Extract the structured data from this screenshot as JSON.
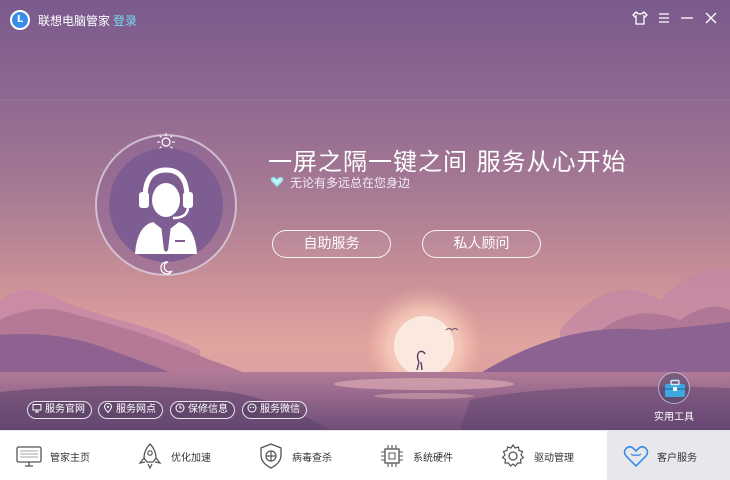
{
  "titlebar": {
    "logo_letter": "L",
    "app_title": "联想电脑管家",
    "login_label": "登录"
  },
  "hero": {
    "headline": "一屏之隔一键之间  服务从心开始",
    "subline": "无论有多远总在您身边",
    "buttons": {
      "self_service": "自助服务",
      "private_advisor": "私人顾问"
    }
  },
  "links": [
    {
      "label": "服务官网",
      "icon": "monitor-icon"
    },
    {
      "label": "服务网点",
      "icon": "location-icon"
    },
    {
      "label": "保修信息",
      "icon": "clock-icon"
    },
    {
      "label": "服务微信",
      "icon": "wechat-icon"
    }
  ],
  "tools": {
    "label": "实用工具",
    "icon": "toolbox-icon"
  },
  "nav": {
    "items": [
      {
        "label": "管家主页",
        "icon": "monitor-icon"
      },
      {
        "label": "优化加速",
        "icon": "rocket-icon"
      },
      {
        "label": "病毒查杀",
        "icon": "shield-icon"
      },
      {
        "label": "系统硬件",
        "icon": "chip-icon"
      },
      {
        "label": "驱动管理",
        "icon": "gear-icon"
      },
      {
        "label": "客户服务",
        "icon": "heart-icon"
      }
    ],
    "active": "客户服务"
  },
  "colors": {
    "accent": "#3a8ee6",
    "login_link": "#79d9f5",
    "active_nav_bg": "#e8e8ec"
  }
}
